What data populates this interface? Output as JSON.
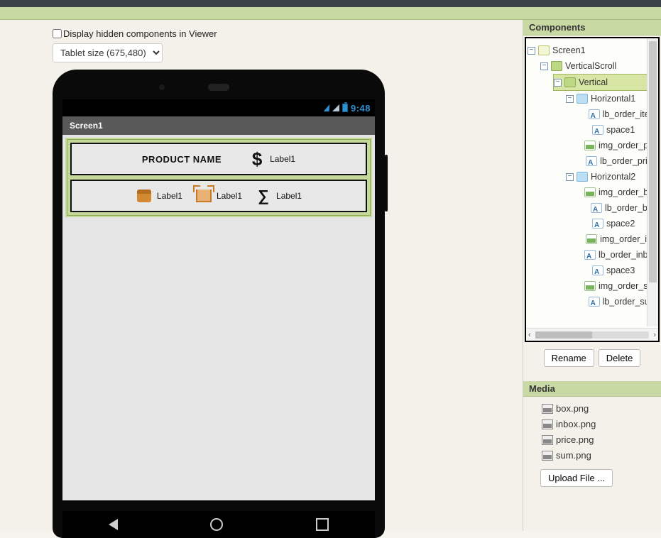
{
  "viewer": {
    "hiddenLabel": "Display hidden components in Viewer",
    "sizeOption": "Tablet size (675,480)"
  },
  "phone": {
    "time": "9:48",
    "screenTitle": "Screen1",
    "row1": {
      "productLabel": "PRODUCT NAME",
      "priceLabel": "Label1"
    },
    "row2": {
      "boxLabel": "Label1",
      "inboxLabel": "Label1",
      "sumLabel": "Label1"
    }
  },
  "componentsPanel": {
    "title": "Components",
    "renameBtn": "Rename",
    "deleteBtn": "Delete",
    "tree": {
      "screen": "Screen1",
      "vscroll": "VerticalScroll",
      "vertical": "Vertical",
      "h1": "Horizontal1",
      "h1_children": {
        "lb_order_item": "lb_order_item",
        "space1": "space1",
        "img_order_price": "img_order_pric",
        "lb_order_price": "lb_order_price"
      },
      "h2": "Horizontal2",
      "h2_children": {
        "img_order_box": "img_order_box",
        "lb_order_box": "lb_order_box",
        "space2": "space2",
        "img_order_inbox": "img_order_inb",
        "lb_order_inbox": "lb_order_inbox",
        "space3": "space3",
        "img_order_sum": "img_order_sum",
        "lb_order_sum": "lb_order_sum"
      }
    }
  },
  "mediaPanel": {
    "title": "Media",
    "files": {
      "f1": "box.png",
      "f2": "inbox.png",
      "f3": "price.png",
      "f4": "sum.png"
    },
    "uploadBtn": "Upload File ..."
  }
}
